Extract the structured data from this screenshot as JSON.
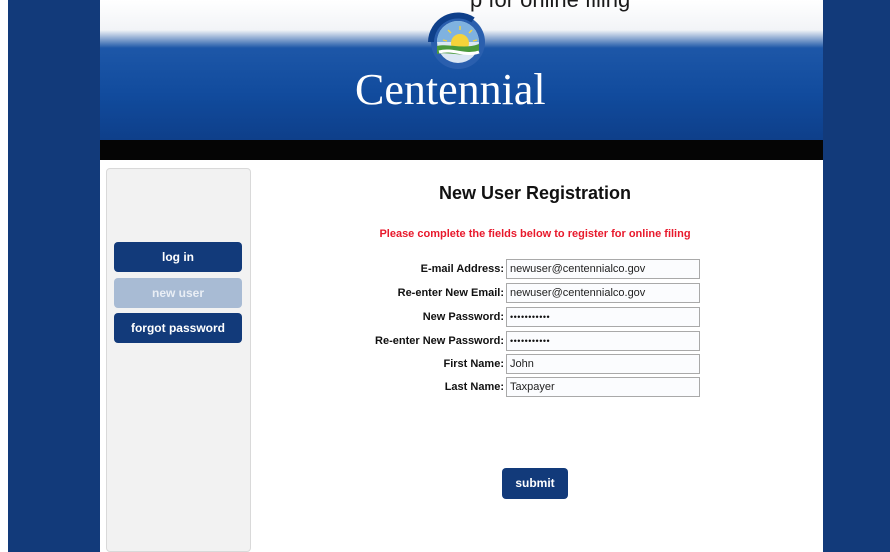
{
  "window": {
    "top_caption_fragment": "p for online filing"
  },
  "brand": {
    "logo_text": "Centennial"
  },
  "colors": {
    "navy": "#123a7a",
    "alert_red": "#e8192c",
    "nav_inactive": "#a8bbd4"
  },
  "sidebar": {
    "items": [
      {
        "label": "log in",
        "state": "default"
      },
      {
        "label": "new user",
        "state": "current"
      },
      {
        "label": "forgot password",
        "state": "default"
      }
    ]
  },
  "form": {
    "title": "New User Registration",
    "instructions": "Please complete the fields below to register for online filing",
    "fields": [
      {
        "label": "E-mail Address:",
        "value": "newuser@centennialco.gov"
      },
      {
        "label": "Re-enter New Email:",
        "value": "newuser@centennialco.gov"
      },
      {
        "label": "New Password:",
        "value": "•••••••••••"
      },
      {
        "label": "Re-enter New Password:",
        "value": "•••••••••••"
      },
      {
        "label": "First Name:",
        "value": "John"
      },
      {
        "label": "Last Name:",
        "value": "Taxpayer"
      }
    ],
    "submit_label": "submit"
  }
}
